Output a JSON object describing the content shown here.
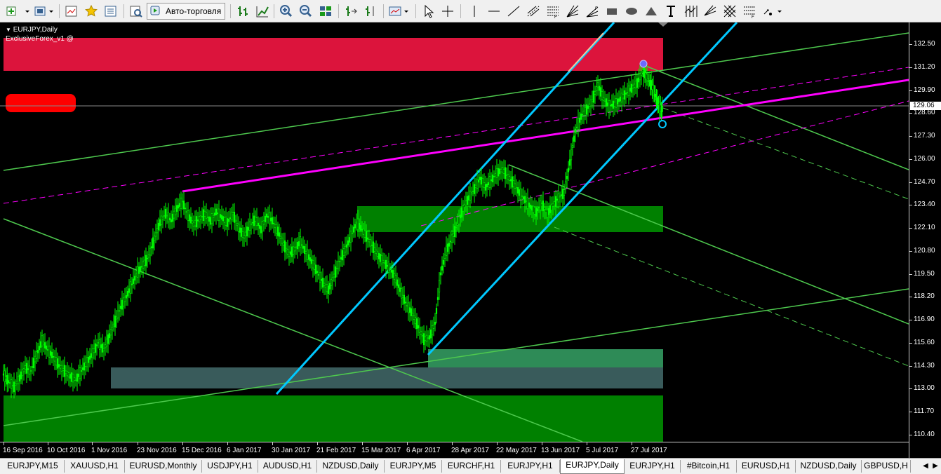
{
  "toolbar": {
    "auto_trading_label": "Авто-торговля",
    "icons": [
      "new-chart-icon",
      "profiles-icon",
      "market-watch-icon",
      "favorites-icon",
      "navigator-icon",
      "strategy-tester-icon",
      "auto-trading-icon",
      "bar-chart-icon",
      "candlestick-icon",
      "zoom-in-icon",
      "zoom-out-icon",
      "tile-windows-icon",
      "autoscroll-icon",
      "chart-shift-icon",
      "templates-icon",
      "cursor-icon",
      "crosshair-icon",
      "vertical-line-icon",
      "trendline-icon",
      "channel-icon",
      "fibonacci-icon",
      "gann-fan-icon",
      "rectangle-icon",
      "triangle-icon",
      "text-icon",
      "cycle-lines-icon",
      "pitchfork-icon",
      "fibo-expansion-icon",
      "arrows-icon"
    ]
  },
  "chart": {
    "title": "EURJPY,Daily",
    "indicator": "ExclusiveForex_v1 @",
    "current_price": "129.06",
    "colors": {
      "background": "#000000",
      "candles": "#00ff00",
      "supply_zone": "#dc143c",
      "demand_zone": "#008000",
      "channel": "#00c8ff",
      "trend_lines": "#4ec94e",
      "magenta_line": "#ff00ff",
      "marker": "#ff0000"
    }
  },
  "price_axis": {
    "labels": [
      "132.50",
      "131.20",
      "129.90",
      "128.60",
      "127.30",
      "126.00",
      "124.70",
      "123.40",
      "122.10",
      "120.80",
      "119.50",
      "118.20",
      "116.90",
      "115.60",
      "114.30",
      "113.00",
      "111.70",
      "110.40"
    ]
  },
  "time_axis": {
    "labels": [
      "16 Sep 2016",
      "10 Oct 2016",
      "1 Nov 2016",
      "23 Nov 2016",
      "15 Dec 2016",
      "6 Jan 2017",
      "30 Jan 2017",
      "21 Feb 2017",
      "15 Mar 2017",
      "6 Apr 2017",
      "28 Apr 2017",
      "22 May 2017",
      "13 Jun 2017",
      "5 Jul 2017",
      "27 Jul 2017"
    ]
  },
  "tabs": {
    "items": [
      "EURJPY,M15",
      "XAUUSD,H1",
      "EURUSD,Monthly",
      "USDJPY,H1",
      "AUDUSD,H1",
      "NZDUSD,Daily",
      "EURJPY,M5",
      "EURCHF,H1",
      "EURJPY,H1",
      "EURJPY,Daily",
      "EURJPY,H1",
      "#Bitcoin,H1",
      "EURUSD,H1",
      "NZDUSD,Daily",
      "GBPUSD,H"
    ],
    "active_index": 9
  }
}
